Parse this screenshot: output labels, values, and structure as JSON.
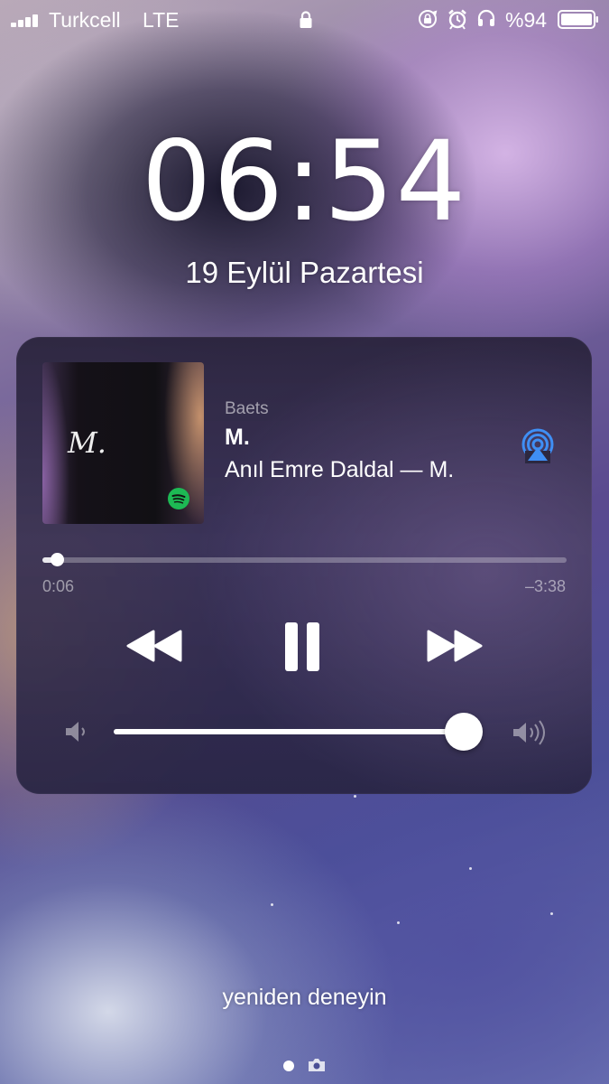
{
  "status_bar": {
    "carrier": "Turkcell",
    "network": "LTE",
    "battery_text": "%94",
    "icons": [
      "signal-icon",
      "lock-icon",
      "rotation-lock-icon",
      "alarm-icon",
      "headphones-icon",
      "battery-icon"
    ]
  },
  "lock_screen": {
    "time": "06:54",
    "date": "19 Eylül Pazartesi",
    "retry_text": "yeniden deneyin"
  },
  "now_playing": {
    "source": "Baets",
    "title": "M.",
    "artist_album": "Anıl Emre Daldal — M.",
    "album_art_letter": "M.",
    "elapsed": "0:06",
    "remaining": "–3:38",
    "progress_fraction": 0.027,
    "volume_fraction": 0.95,
    "accent_color": "#3f8ff5",
    "spotify_color": "#1db954"
  }
}
